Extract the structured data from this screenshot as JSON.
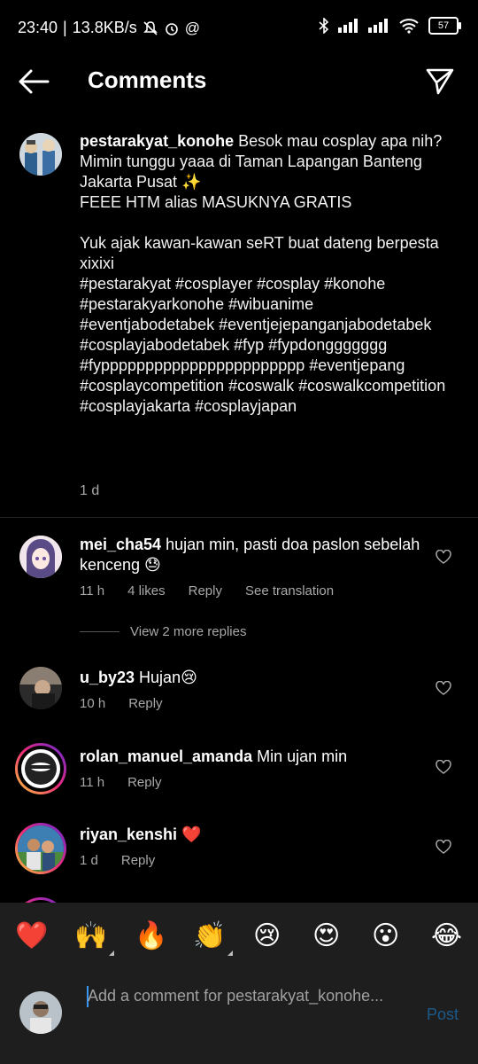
{
  "status_bar": {
    "time": "23:40",
    "speed": "13.8KB/s",
    "battery": "57"
  },
  "header": {
    "title": "Comments"
  },
  "caption": {
    "username": "pestarakyat_konohe",
    "text": " Besok mau cosplay apa nih?\nMimin tunggu yaaa di Taman Lapangan Banteng Jakarta Pusat ✨\nFEEE HTM alias MASUKNYA GRATIS\n\nYuk ajak kawan-kawan seRT buat dateng berpesta xixixi\n#pestarakyat #cosplayer #cosplay #konohe #pestarakyarkonohe #wibuanime #eventjabodetabek #eventjejepanganjabodetabek #cosplayjabodetabek #fyp #fypdonggggggg #fyppppppppppppppppppppppp #eventjepang #cosplaycompetition #coswalk #coswalkcompetition #cosplayjakarta #cosplayjapan",
    "time": "1 d"
  },
  "comments": [
    {
      "username": "mei_cha54",
      "text": " hujan min, pasti doa paslon sebelah kenceng 😓",
      "time": "11 h",
      "likes": "4 likes",
      "reply": "Reply",
      "translate": "See translation",
      "view_replies": "View 2 more replies"
    },
    {
      "username": "u_by23",
      "text": " Hujan😢",
      "time": "10 h",
      "reply": "Reply"
    },
    {
      "username": "rolan_manuel_amanda",
      "text": " Min ujan min",
      "time": "11 h",
      "reply": "Reply"
    },
    {
      "username": "riyan_kenshi",
      "text": " ❤️",
      "time": "1 d",
      "reply": "Reply"
    }
  ],
  "emoji_bar": [
    "❤️",
    "🙌",
    "🔥",
    "👏",
    "😢",
    "😍",
    "😮",
    "😂"
  ],
  "composer": {
    "placeholder": "Add a comment for pestarakyat_konohe...",
    "post_label": "Post"
  },
  "colors": {
    "background": "#000000",
    "secondary_text": "#a8a8a8",
    "post_disabled": "#1c5a8a",
    "panel": "#1e1e1e"
  }
}
